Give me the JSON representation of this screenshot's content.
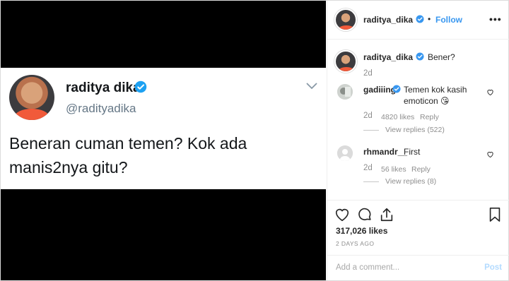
{
  "tweet": {
    "name": "raditya dika",
    "handle": "@radityadika",
    "text": "Beneran cuman temen? Kok ada manis2nya gitu?"
  },
  "header": {
    "username": "raditya_dika",
    "separator": "•",
    "follow_label": "Follow",
    "more_label": "•••"
  },
  "caption": {
    "username": "raditya_dika",
    "text": "Bener?",
    "time": "2d"
  },
  "comments": [
    {
      "username": "gadiiing",
      "text": "Temen kok kasih emoticon 😘",
      "time": "2d",
      "likes": "4820 likes",
      "reply_label": "Reply",
      "view_replies": "View replies (522)"
    },
    {
      "username": "rhmandr__",
      "text": "First",
      "time": "2d",
      "likes": "56 likes",
      "reply_label": "Reply",
      "view_replies": "View replies (8)"
    }
  ],
  "actions": {
    "likes": "317,026 likes",
    "posted_ago": "2 DAYS AGO"
  },
  "comment_box": {
    "placeholder": "Add a comment...",
    "post_label": "Post"
  },
  "colors": {
    "link_blue": "#3897f0",
    "verified_blue": "#1da1f2",
    "post_disabled": "#b3dbff"
  }
}
